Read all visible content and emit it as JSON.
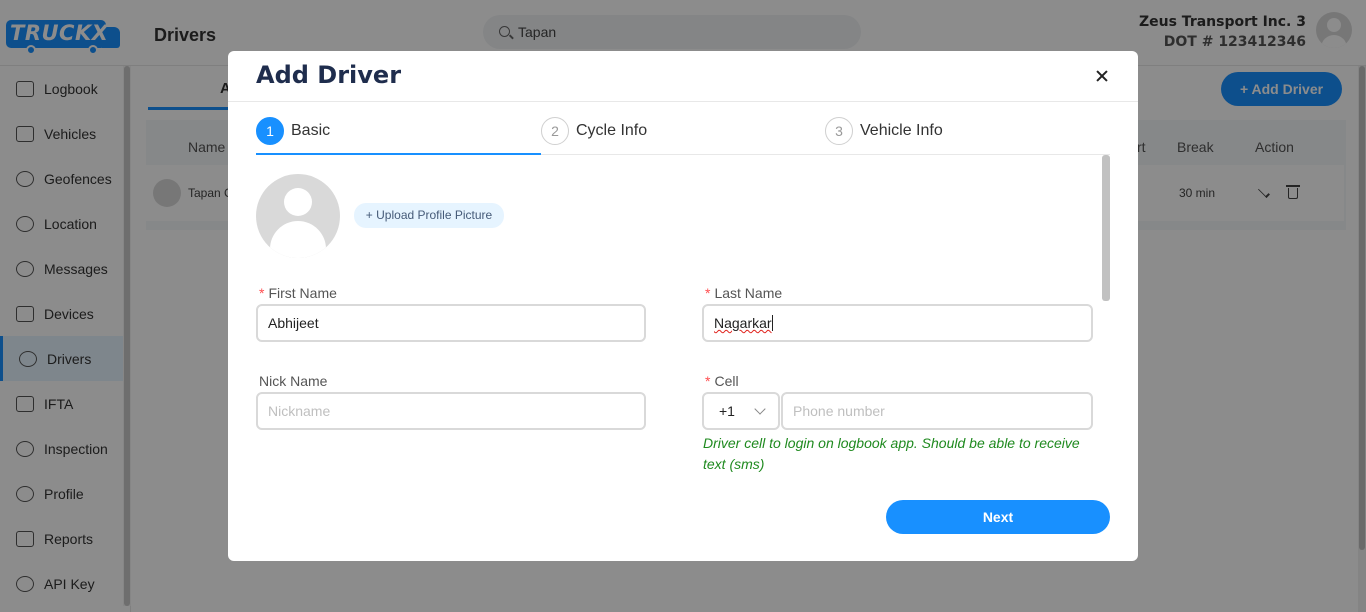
{
  "app": {
    "logo_text": "TRUCKX",
    "page_title": "Drivers",
    "search_value": "Tapan",
    "company_name": "Zeus Transport Inc. 3",
    "dot_number": "DOT # 123412346"
  },
  "sidebar": {
    "items": [
      {
        "label": "Logbook",
        "icon": "chart-icon"
      },
      {
        "label": "Vehicles",
        "icon": "truck-icon"
      },
      {
        "label": "Geofences",
        "icon": "geofence-icon"
      },
      {
        "label": "Location",
        "icon": "location-pin-icon"
      },
      {
        "label": "Messages",
        "icon": "chat-icon"
      },
      {
        "label": "Devices",
        "icon": "device-icon"
      },
      {
        "label": "Drivers",
        "icon": "steering-wheel-icon",
        "active": true
      },
      {
        "label": "IFTA",
        "icon": "fuel-icon"
      },
      {
        "label": "Inspection",
        "icon": "inspection-icon"
      },
      {
        "label": "Profile",
        "icon": "person-icon"
      },
      {
        "label": "Reports",
        "icon": "report-icon"
      },
      {
        "label": "API Key",
        "icon": "key-icon"
      }
    ]
  },
  "content": {
    "tab_label": "A",
    "add_driver_label": "+ Add Driver",
    "columns": [
      "Name",
      "rt",
      "Break",
      "Action"
    ],
    "rows": [
      {
        "name": "Tapan C",
        "break": "30 min"
      }
    ]
  },
  "modal": {
    "title": "Add Driver",
    "steps": [
      {
        "num": "1",
        "label": "Basic",
        "active": true
      },
      {
        "num": "2",
        "label": "Cycle Info",
        "active": false
      },
      {
        "num": "3",
        "label": "Vehicle Info",
        "active": false
      }
    ],
    "upload_label": "+ Upload Profile Picture",
    "fields": {
      "first_name_label": "First Name",
      "first_name_value": "Abhijeet",
      "last_name_label": "Last Name",
      "last_name_value": "Nagarkar",
      "nick_name_label": "Nick Name",
      "nick_name_placeholder": "Nickname",
      "cell_label": "Cell",
      "country_code": "+1",
      "phone_placeholder": "Phone number"
    },
    "required_marker": "*",
    "help_text": "Driver cell to login on logbook app. Should be able to receive text (sms)",
    "next_label": "Next"
  },
  "colors": {
    "accent": "#1890ff",
    "help_text": "#1f8a1f",
    "required": "#ff4d4f",
    "title": "#1f2d4d"
  }
}
